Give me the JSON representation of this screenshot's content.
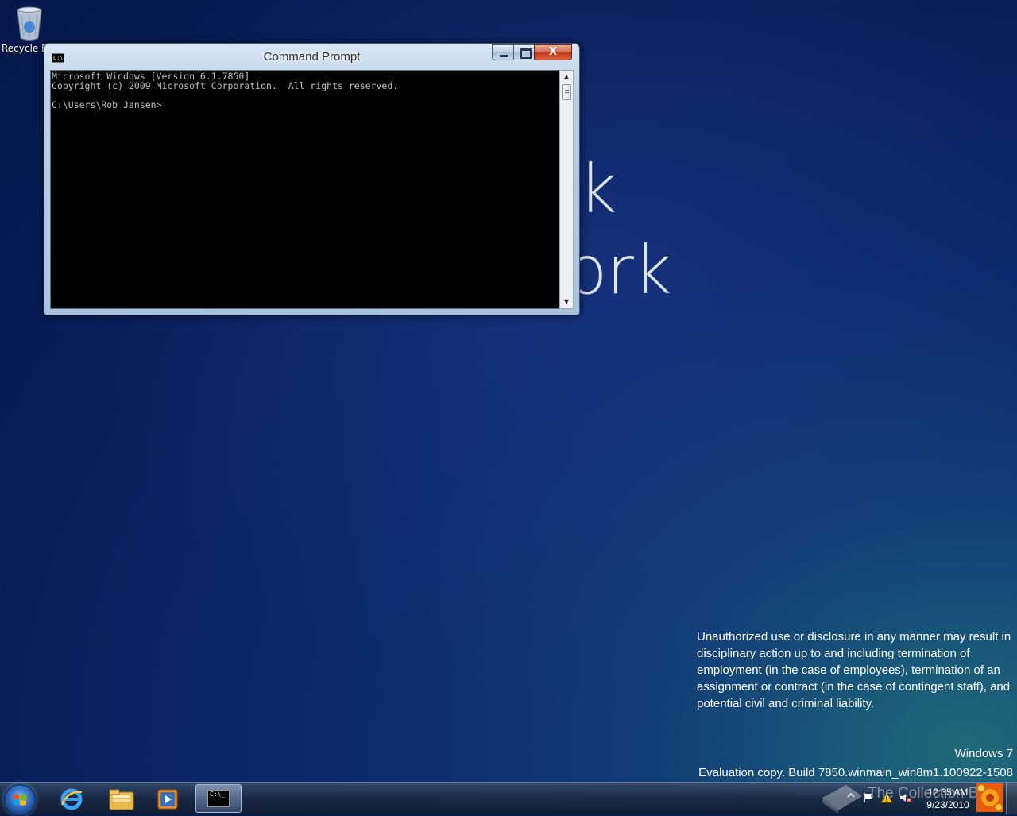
{
  "desktop": {
    "background_text_fragments": [
      "k",
      "ork"
    ],
    "icons": [
      {
        "label": "Recycle Bin",
        "icon": "recycle-bin-icon"
      }
    ]
  },
  "cmd_window": {
    "title": "Command Prompt",
    "icon": "cmd-icon",
    "icon_text": "C:\\.",
    "controls": {
      "minimize": "minimize-icon",
      "maximize": "maximize-icon",
      "close": "close-icon",
      "close_label": "X"
    },
    "console_lines": [
      "Microsoft Windows [Version 6.1.7850]",
      "Copyright (c) 2009 Microsoft Corporation.  All rights reserved.",
      "",
      "C:\\Users\\Rob Jansen>"
    ]
  },
  "disclaimer": "Unauthorized use or disclosure in any manner may result in disciplinary action up to and including termination of employment (in the case of employees), termination of an assignment or contract (in the case of contingent staff), and potential civil and criminal liability.",
  "watermark": {
    "os": "Windows 7",
    "build": "Evaluation copy. Build 7850.winmain_win8m1.100922-1508",
    "overlay": "The Collection Book"
  },
  "taskbar": {
    "start": "windows-start-icon",
    "pinned": [
      {
        "name": "internet-explorer",
        "icon": "internet-explorer-icon"
      },
      {
        "name": "windows-explorer",
        "icon": "folder-icon"
      },
      {
        "name": "media-player",
        "icon": "media-player-icon"
      },
      {
        "name": "command-prompt",
        "icon": "cmd-icon",
        "active": true
      }
    ],
    "cmd_icon_text": "C:\\_",
    "tray": {
      "icons": [
        "show-hidden-icon",
        "action-center-flag-icon",
        "warning-icon",
        "volume-muted-icon"
      ],
      "time": "12:35 AM",
      "date": "9/23/2010"
    }
  }
}
